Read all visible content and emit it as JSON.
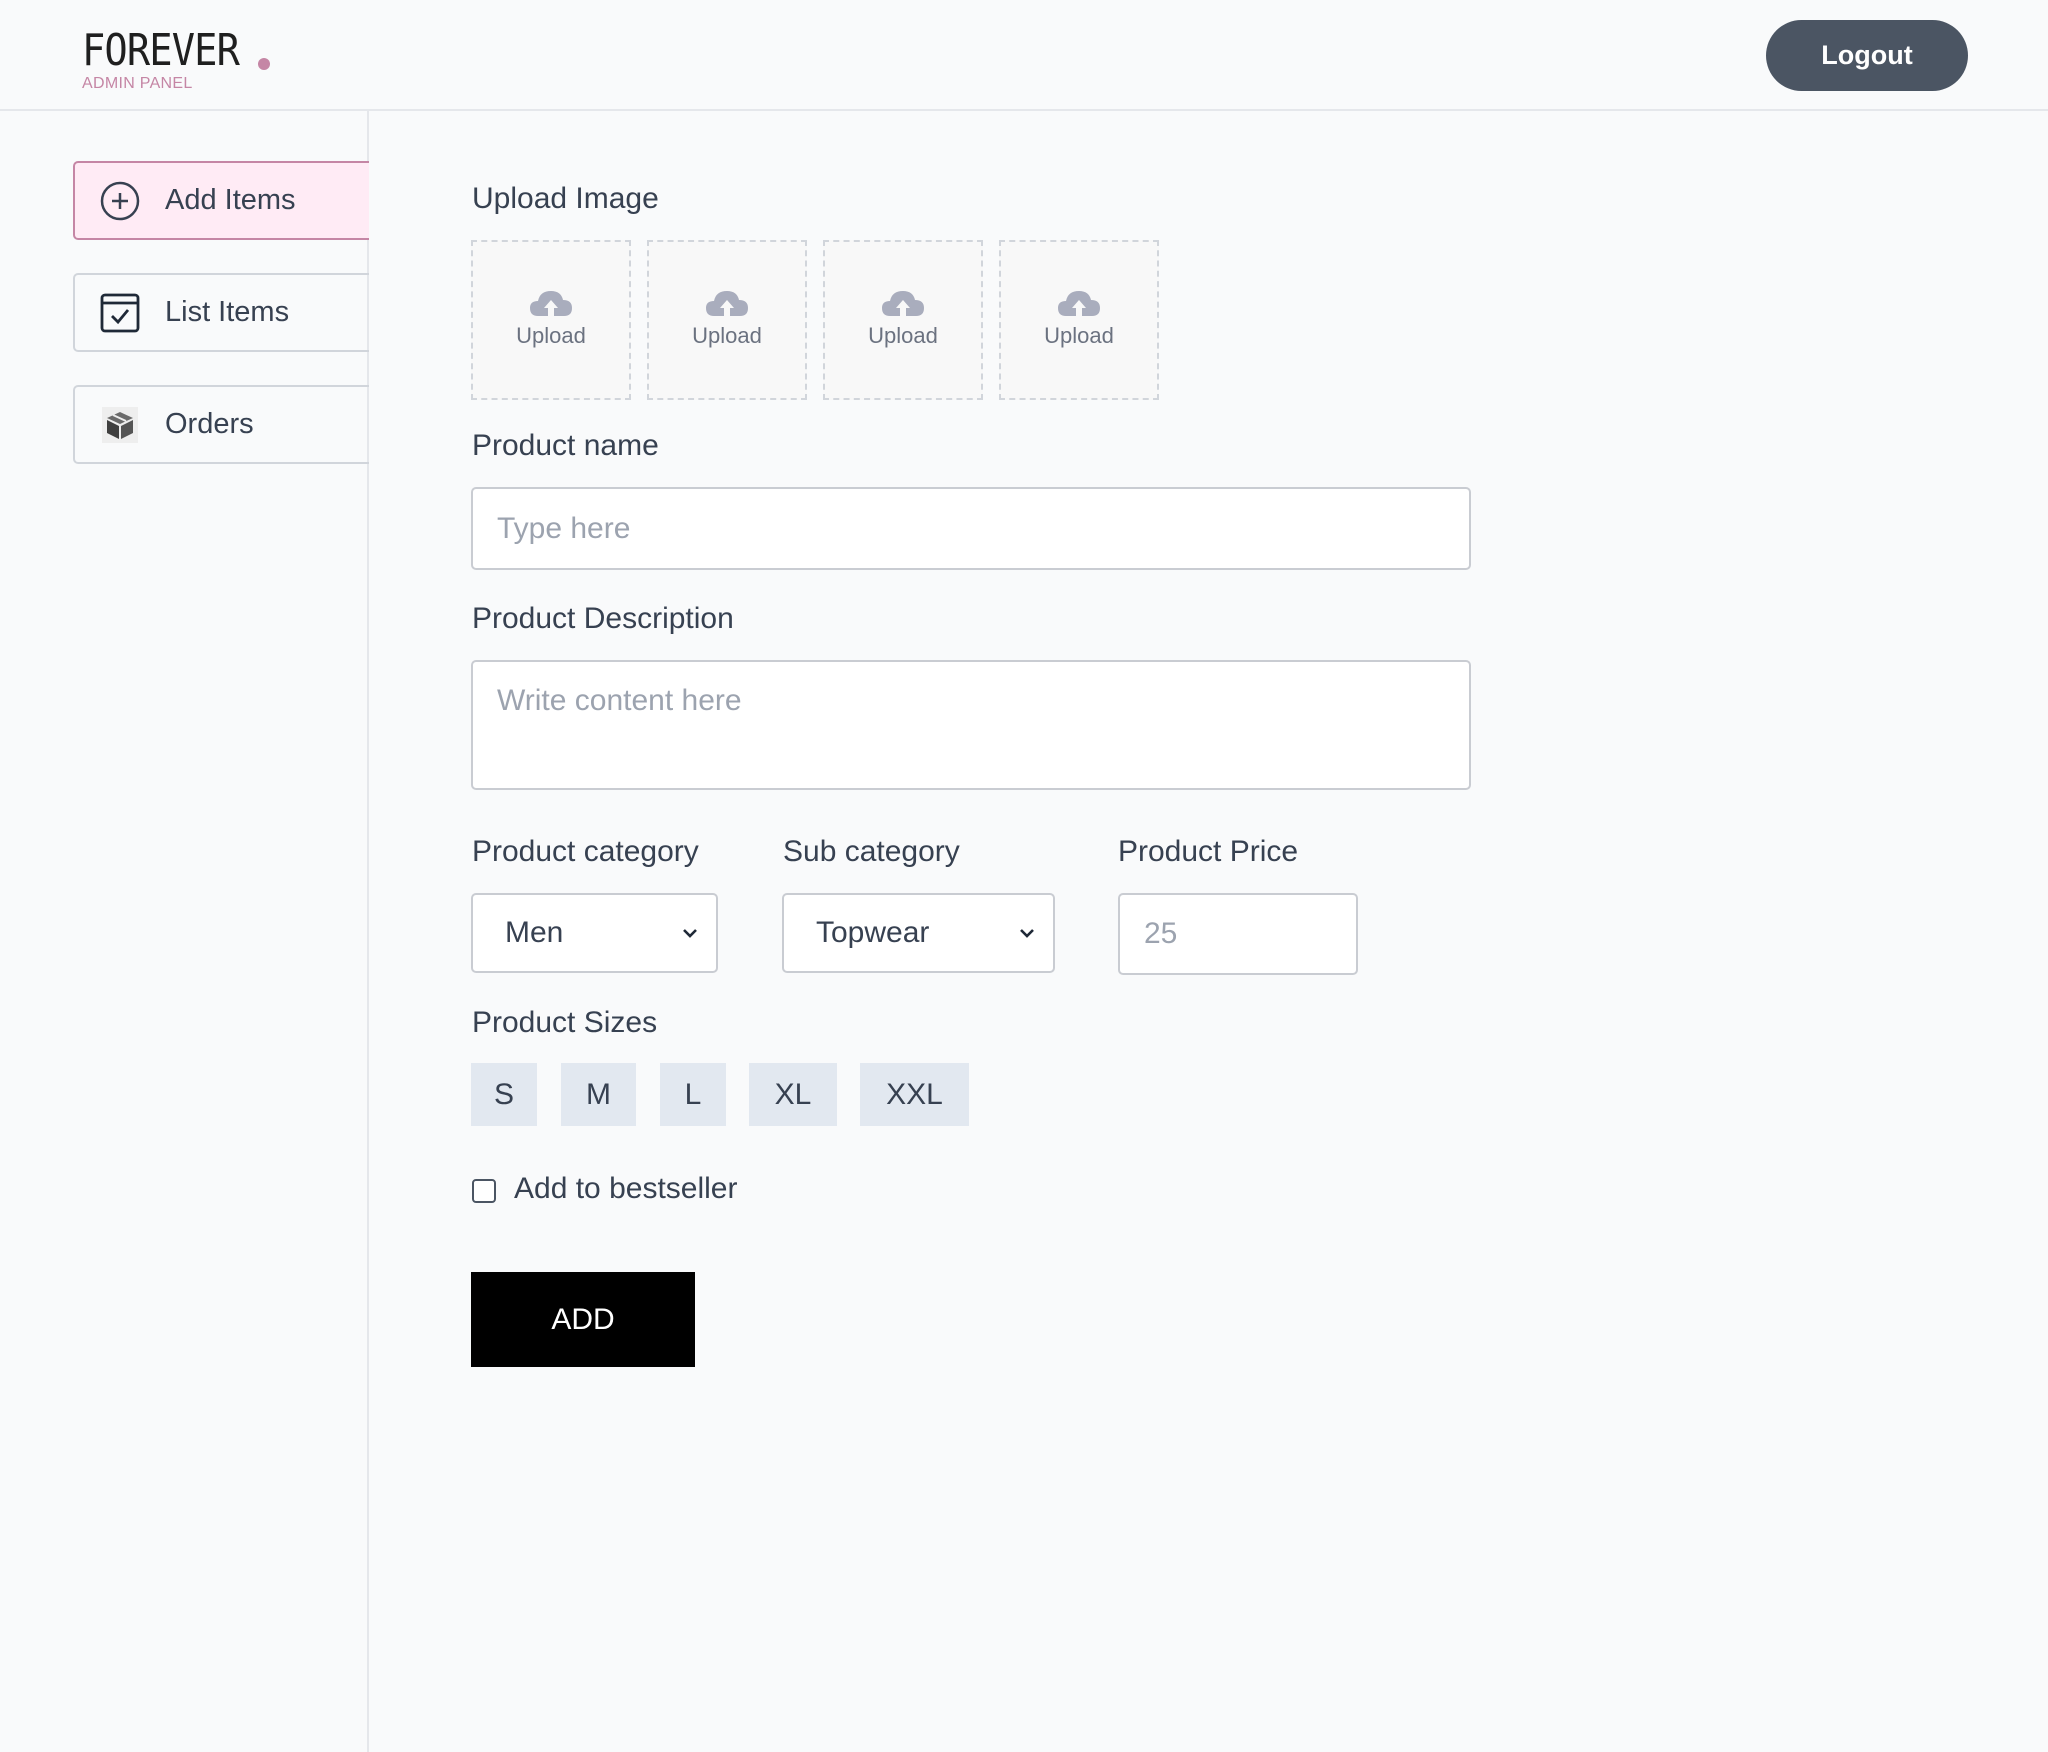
{
  "header": {
    "logo_text": "FOREVER",
    "logo_subtitle": "ADMIN PANEL",
    "logout_label": "Logout"
  },
  "sidebar": {
    "items": [
      {
        "label": "Add Items",
        "icon": "add-circle-icon",
        "active": true
      },
      {
        "label": "List Items",
        "icon": "checklist-icon",
        "active": false
      },
      {
        "label": "Orders",
        "icon": "package-icon",
        "active": false
      }
    ]
  },
  "form": {
    "upload_heading": "Upload Image",
    "upload_slots": [
      {
        "label": "Upload",
        "icon": "cloud-upload-icon"
      },
      {
        "label": "Upload",
        "icon": "cloud-upload-icon"
      },
      {
        "label": "Upload",
        "icon": "cloud-upload-icon"
      },
      {
        "label": "Upload",
        "icon": "cloud-upload-icon"
      }
    ],
    "product_name": {
      "label": "Product name",
      "placeholder": "Type here",
      "value": ""
    },
    "description": {
      "label": "Product Description",
      "placeholder": "Write content here",
      "value": ""
    },
    "category": {
      "label": "Product category",
      "selected": "Men"
    },
    "subcategory": {
      "label": "Sub category",
      "selected": "Topwear"
    },
    "price": {
      "label": "Product Price",
      "placeholder": "25",
      "value": ""
    },
    "sizes": {
      "label": "Product Sizes",
      "options": [
        "S",
        "M",
        "L",
        "XL",
        "XXL"
      ]
    },
    "bestseller": {
      "label": "Add to bestseller",
      "checked": false
    },
    "submit_label": "ADD"
  },
  "colors": {
    "accent_pink": "#c586a5",
    "active_bg": "#ffebf5",
    "logout_bg": "#4b5563",
    "chip_bg": "#e2e8f0",
    "submit_bg": "#000000"
  }
}
